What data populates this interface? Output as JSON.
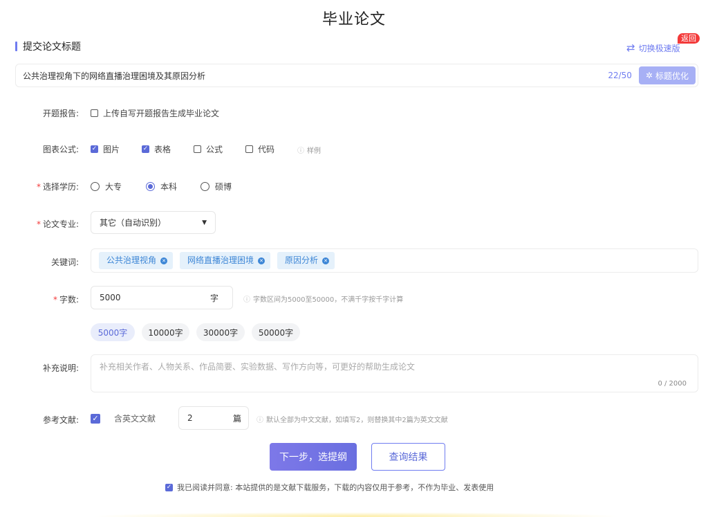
{
  "page": {
    "title": "毕业论文"
  },
  "section": {
    "title": "提交论文标题"
  },
  "header": {
    "switch_label": "切换极速版",
    "return_badge": "返回"
  },
  "title_field": {
    "value": "公共治理视角下的网络直播治理困境及其原因分析",
    "count": "22/50",
    "optimize_label": "标题优化"
  },
  "proposal": {
    "label": "开题报告:",
    "checkbox_label": "上传自写开题报告生成毕业论文",
    "checked": false
  },
  "figures": {
    "label": "图表公式:",
    "options": [
      {
        "label": "图片",
        "checked": true
      },
      {
        "label": "表格",
        "checked": true
      },
      {
        "label": "公式",
        "checked": false
      },
      {
        "label": "代码",
        "checked": false
      }
    ],
    "sample_label": "样例"
  },
  "education": {
    "required_mark": "*",
    "label": "选择学历:",
    "options": [
      "大专",
      "本科",
      "硕博"
    ],
    "selected": "本科"
  },
  "major": {
    "required_mark": "*",
    "label": "论文专业:",
    "value": "其它（自动识别）"
  },
  "keywords": {
    "label": "关键词:",
    "tags": [
      "公共治理视角",
      "网络直播治理困境",
      "原因分析"
    ]
  },
  "words": {
    "required_mark": "*",
    "label": "字数:",
    "value": "5000",
    "unit": "字",
    "hint": "字数区间为5000至50000，不满千字按千字计算",
    "presets": [
      "5000字",
      "10000字",
      "30000字",
      "50000字"
    ],
    "active_preset": "5000字"
  },
  "notes": {
    "label": "补充说明:",
    "placeholder": "补充相关作者、人物关系、作品简要、实验数据、写作方向等，可更好的帮助生成论文",
    "count": "0 / 2000"
  },
  "references": {
    "label": "参考文献:",
    "checked": true,
    "checkbox_label": "含英文文献",
    "value": "2",
    "unit": "篇",
    "hint": "默认全部为中文文献，如填写2，则替换其中2篇为英文文献"
  },
  "actions": {
    "next_label": "下一步，选提纲",
    "query_label": "查询结果"
  },
  "agreement": {
    "checked": true,
    "text": "我已阅读并同意: 本站提供的是文献下载服务，下载的内容仅用于参考，不作为毕业、发表使用"
  },
  "colors": {
    "accent": "#6f7cf0",
    "required": "#f33a3a",
    "tag": "#3d86d6"
  }
}
